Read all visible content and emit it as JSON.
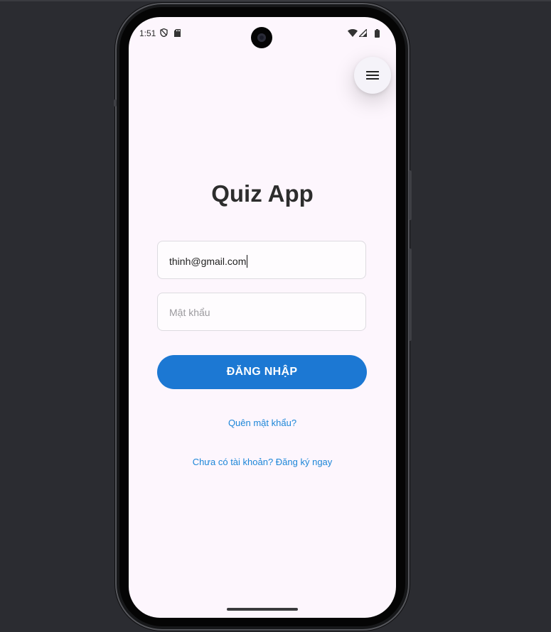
{
  "status_bar": {
    "time": "1:51",
    "icons": [
      "shield-icon",
      "sd-card-icon",
      "wifi-icon",
      "signal-icon",
      "battery-icon"
    ]
  },
  "menu": {
    "icon": "hamburger-menu-icon"
  },
  "login": {
    "title": "Quiz App",
    "email_value": "thinh@gmail.com",
    "password_placeholder": "Mật khẩu",
    "login_button": "ĐĂNG NHẬP",
    "forgot_password": "Quên mật khẩu?",
    "register": "Chưa có tài khoản? Đăng ký ngay"
  },
  "colors": {
    "primary": "#1c78d3",
    "link": "#1c86d8",
    "screen_background": "#fdf6fd",
    "desktop_background": "#2b2c31"
  }
}
